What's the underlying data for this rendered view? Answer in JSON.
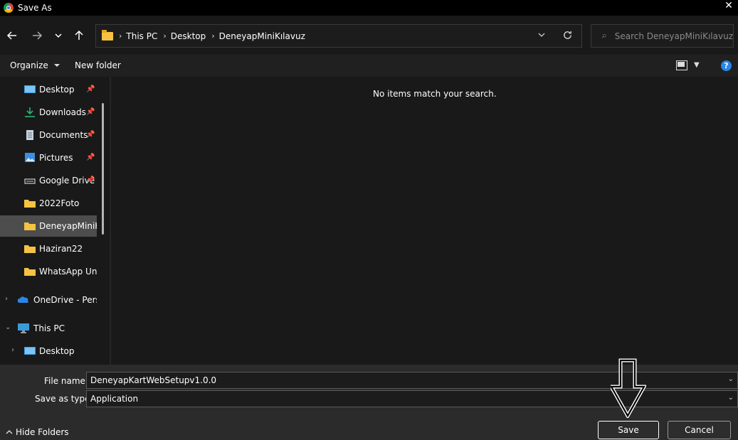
{
  "window": {
    "title": "Save As",
    "app_icon": "chrome-icon",
    "close_glyph": "✕"
  },
  "nav": {
    "back_icon": "arrow-left-icon",
    "forward_icon": "arrow-right-icon",
    "recent_icon": "chevron-down-icon",
    "up_icon": "arrow-up-icon",
    "breadcrumbs": [
      "This PC",
      "Desktop",
      "DeneyapMiniKılavuz"
    ],
    "search_placeholder": "Search DeneyapMiniKılavuz"
  },
  "commandbar": {
    "organize_label": "Organize",
    "new_folder_label": "New folder",
    "help_glyph": "?"
  },
  "sidebar": {
    "items": [
      {
        "label": "Desktop",
        "icon": "desktop-icon",
        "pinned": true
      },
      {
        "label": "Downloads",
        "icon": "download-icon",
        "pinned": true
      },
      {
        "label": "Documents",
        "icon": "document-icon",
        "pinned": true
      },
      {
        "label": "Pictures",
        "icon": "pictures-icon",
        "pinned": true
      },
      {
        "label": "Google Drive",
        "icon": "drive-icon",
        "pinned": true
      },
      {
        "label": "2022Foto",
        "icon": "folder-icon",
        "pinned": false
      },
      {
        "label": "DeneyapMiniKılavuz",
        "icon": "folder-icon",
        "pinned": false,
        "selected": true
      },
      {
        "label": "Haziran22",
        "icon": "folder-icon",
        "pinned": false
      },
      {
        "label": "WhatsApp Unknown",
        "icon": "folder-icon",
        "pinned": false
      },
      {
        "label": "OneDrive - Personal",
        "icon": "onedrive-icon",
        "pinned": false
      },
      {
        "label": "This PC",
        "icon": "this-pc-icon",
        "pinned": false
      },
      {
        "label": "Desktop",
        "icon": "desktop-icon",
        "pinned": false
      }
    ]
  },
  "content": {
    "empty_message": "No items match your search."
  },
  "footer": {
    "filename_label": "File name:",
    "filename_value": "DeneyapKartWebSetupv1.0.0",
    "savetype_label": "Save as type:",
    "savetype_value": "Application",
    "hide_folders_label": "Hide Folders",
    "save_label": "Save",
    "cancel_label": "Cancel"
  },
  "colors": {
    "accent": "#2a86e6",
    "folder": "#f5c242",
    "background": "#191919"
  }
}
